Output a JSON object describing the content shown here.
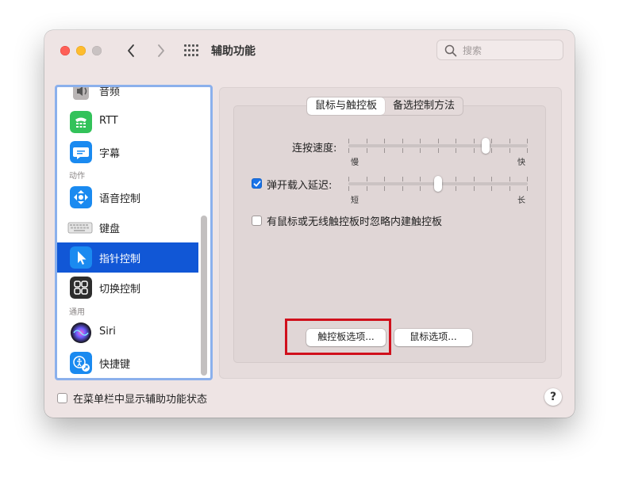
{
  "window": {
    "title": "辅助功能",
    "search_placeholder": "搜索"
  },
  "sidebar": {
    "items": [
      {
        "label": "音频",
        "icon": "speaker-icon"
      },
      {
        "label": "RTT",
        "icon": "rtt-phone-icon"
      },
      {
        "label": "字幕",
        "icon": "captions-icon"
      },
      {
        "label": "语音控制",
        "icon": "voice-control-icon"
      },
      {
        "label": "键盘",
        "icon": "keyboard-icon"
      },
      {
        "label": "指针控制",
        "icon": "pointer-icon",
        "selected": true
      },
      {
        "label": "切换控制",
        "icon": "switch-control-icon"
      },
      {
        "label": "Siri",
        "icon": "siri-icon"
      },
      {
        "label": "快捷键",
        "icon": "shortcut-icon"
      }
    ],
    "sections": [
      "动作",
      "通用"
    ]
  },
  "tabs": [
    {
      "label": "鼠标与触控板",
      "active": true
    },
    {
      "label": "备选控制方法",
      "active": false
    }
  ],
  "settings": {
    "double_click_speed": {
      "label": "连按速度:",
      "min_label": "慢",
      "max_label": "快",
      "value": 0.78
    },
    "spring_loading_delay": {
      "label": "弹开载入延迟:",
      "min_label": "短",
      "max_label": "长",
      "value": 0.5,
      "checked": true
    },
    "ignore_trackpad": {
      "label": "有鼠标或无线触控板时忽略内建触控板",
      "checked": false
    }
  },
  "buttons": {
    "trackpad_options": "触控板选项...",
    "mouse_options": "鼠标选项..."
  },
  "footer": {
    "menu_bar_label": "在菜单栏中显示辅助功能状态",
    "menu_bar_checked": false,
    "help": "?"
  },
  "colors": {
    "accent": "#1157d6",
    "checkbox_blue": "#1a73e8",
    "highlight_red": "#d0101c",
    "window_bg": "#eee4e4"
  }
}
